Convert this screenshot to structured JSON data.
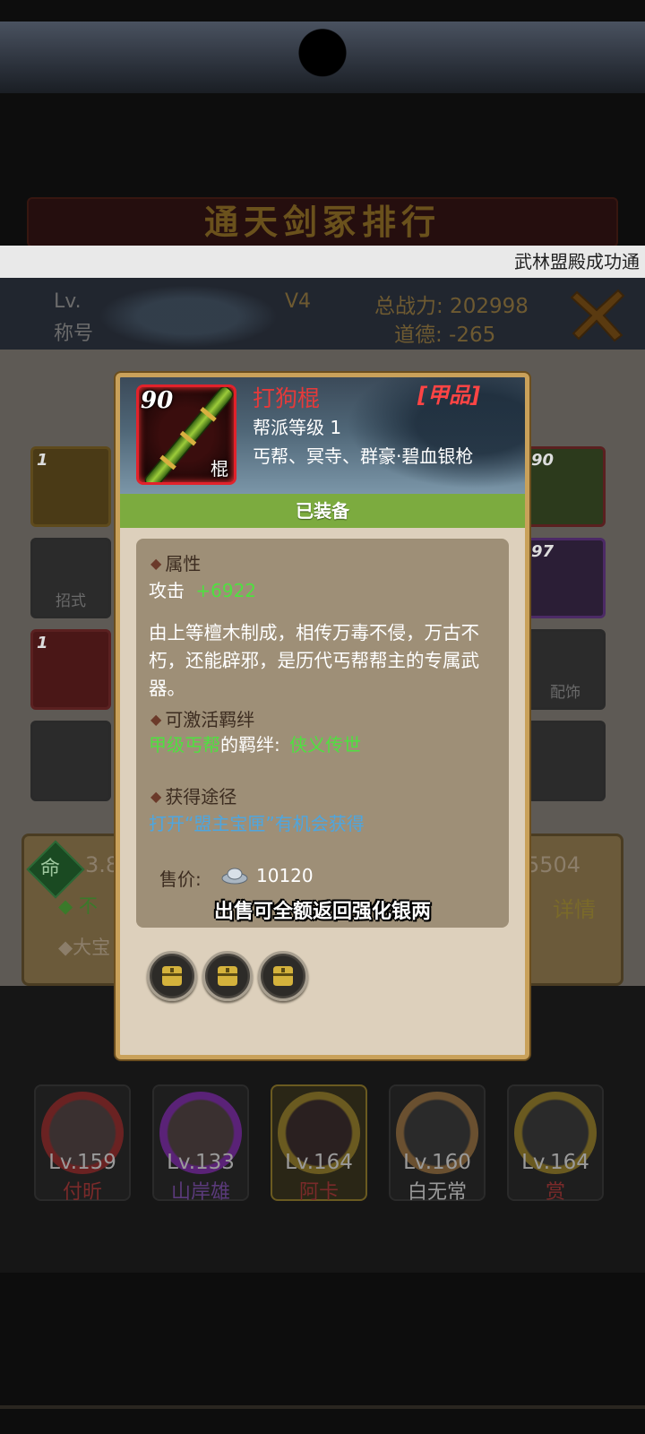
{
  "marquee": {
    "text": "武林盟殿成功通"
  },
  "background": {
    "faint_title": "通天剑冢排行",
    "header": {
      "level_label": "Lv.",
      "title_label": "称号",
      "vip": "V4",
      "power": "总战力: 202998",
      "morality": "道德: -265"
    },
    "slots": [
      {
        "num": "1",
        "label": "",
        "color": "gold"
      },
      {
        "num": "",
        "label": "招式",
        "color": "dark"
      },
      {
        "num": "1",
        "label": "",
        "color": "red"
      },
      {
        "num": "",
        "label": "",
        "color": "dark"
      },
      {
        "num": "90",
        "label": "",
        "color": "green"
      },
      {
        "num": "97",
        "label": "",
        "color": "purple"
      },
      {
        "num": "",
        "label": "配饰",
        "color": "dark"
      },
      {
        "num": "",
        "label": "",
        "color": "dark"
      }
    ],
    "stats": {
      "ming": "命",
      "left_value": "3.8",
      "right_value": "5504",
      "line1": "◆ 不",
      "line2": "◆大宝",
      "detail": "详情"
    },
    "heroes": [
      {
        "level": "Lv.159",
        "name": "付昕",
        "name_color": "#7a2a2a",
        "ring": "#8a2a2a",
        "selected": false
      },
      {
        "level": "Lv.133",
        "name": "山岸雄",
        "name_color": "#5a3a7a",
        "ring": "#6a2a8a",
        "selected": false
      },
      {
        "level": "Lv.164",
        "name": "阿卡",
        "name_color": "#7a2a2a",
        "ring": "#8a6a1a",
        "selected": true
      },
      {
        "level": "Lv.160",
        "name": "白无常",
        "name_color": "#9a9a9a",
        "ring": "#8a6a3a",
        "selected": false
      },
      {
        "level": "Lv.164",
        "name": "赏",
        "name_color": "#7a2a2a",
        "ring": "#8a6a1a",
        "selected": false
      }
    ]
  },
  "item": {
    "level": "90",
    "kind": "棍",
    "name": "打狗棍",
    "grade": "[甲品]",
    "requirement": "帮派等级 1",
    "factions": "丐帮、冥寺、群豪·碧血银枪",
    "status": "已装备",
    "attributes_title": "属性",
    "attack_label": "攻击",
    "attack_value": "+6922",
    "description": "由上等檀木制成，相传万毒不侵，万古不朽，还能辟邪，是历代丐帮帮主的专属武器。",
    "bond_title": "可激活羁绊",
    "bond_group": "甲级丐帮",
    "bond_mid": "的羁绊:",
    "bond_name": "侠义传世",
    "source_title": "获得途径",
    "source_text": "打开“盟主宝匣”有机会获得",
    "price_label": "售价:",
    "price_value": "10120",
    "sell_note": "出售可全额返回强化银两",
    "gem_slots": 3,
    "colors": {
      "name": "#e63a3a",
      "equipped_bar": "#7cab3f",
      "green_text": "#4fe040",
      "blue_text": "#4da6e0"
    }
  }
}
